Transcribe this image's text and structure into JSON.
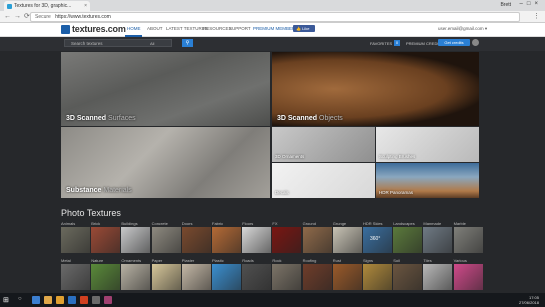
{
  "browser": {
    "tab_title": "Textures for 3D, graphic...",
    "tab_close": "×",
    "profile": "Brett",
    "window_controls": "–□×",
    "nav_buttons": "←→⟳",
    "security_label": "Secure",
    "url": "https://www.textures.com",
    "menu_glyph": "⋮"
  },
  "header": {
    "logo": "textures.com",
    "nav": [
      "HOME",
      "ABOUT",
      "LATEST TEXTURES",
      "RESOURCES",
      "SUPPORT",
      "PREMIUM MEMBER"
    ],
    "fb_like": "👍 Like 72K",
    "user": "user.email@gmail.com ▾"
  },
  "search": {
    "placeholder": "Search textures",
    "filter": "All",
    "button_icon": "search-icon",
    "favorites_label": "FAVORITES",
    "favorites_count": "0",
    "premium_label": "PREMIUM CREDITS",
    "premium_count": "0",
    "upgrade_label": "Get credits"
  },
  "hero": {
    "surfaces": {
      "lead": "3D Scanned",
      "rest": "Surfaces"
    },
    "objects": {
      "lead": "3D Scanned",
      "rest": "Objects"
    },
    "substance": {
      "lead": "Substance",
      "rest": "Materials"
    },
    "ornaments": "3D Ornaments",
    "sculpting": "Sculpting Brushes",
    "decals": "Decals",
    "hdr": "HDR Panoramas"
  },
  "photo_textures": {
    "title": "Photo Textures",
    "row1": [
      "Animals",
      "Brick",
      "Buildings",
      "Concrete",
      "Doors",
      "Fabric",
      "Floors",
      "FX",
      "Ground",
      "Grunge",
      "HDR Skies",
      "Landscapes",
      "Manmade",
      "Marble"
    ],
    "row2": [
      "Metal",
      "Nature",
      "Ornaments",
      "Paper",
      "Plaster",
      "Plastic",
      "Roads",
      "Rock",
      "Roofing",
      "Rust",
      "Signs",
      "Soil",
      "Tiles",
      "Various"
    ],
    "hdr_badge": "360°",
    "row1_colors": [
      "#6b6a5e",
      "#9a4a36",
      "#c8c9ca",
      "#8e8a80",
      "#7a4a2e",
      "#b46a36",
      "#d8d8d8",
      "#7a1612",
      "#8f6a4a",
      "#c8c3b5",
      "#3a6fa0",
      "#5b7a3c",
      "#6f7a84",
      "#7f7f7a"
    ],
    "row2_colors": [
      "#6a6a6a",
      "#5a8a3a",
      "#b8b2a4",
      "#d7c79a",
      "#c4b8a6",
      "#3b8fd0",
      "#505050",
      "#7c7468",
      "#6f3d2a",
      "#9a5a2a",
      "#b08a3c",
      "#6a5540",
      "#b9b9b9",
      "#d04a8a"
    ]
  },
  "taskbar": {
    "start": "⊞",
    "search": "○",
    "clock_time": "17:05",
    "clock_date": "27/06/2018"
  }
}
